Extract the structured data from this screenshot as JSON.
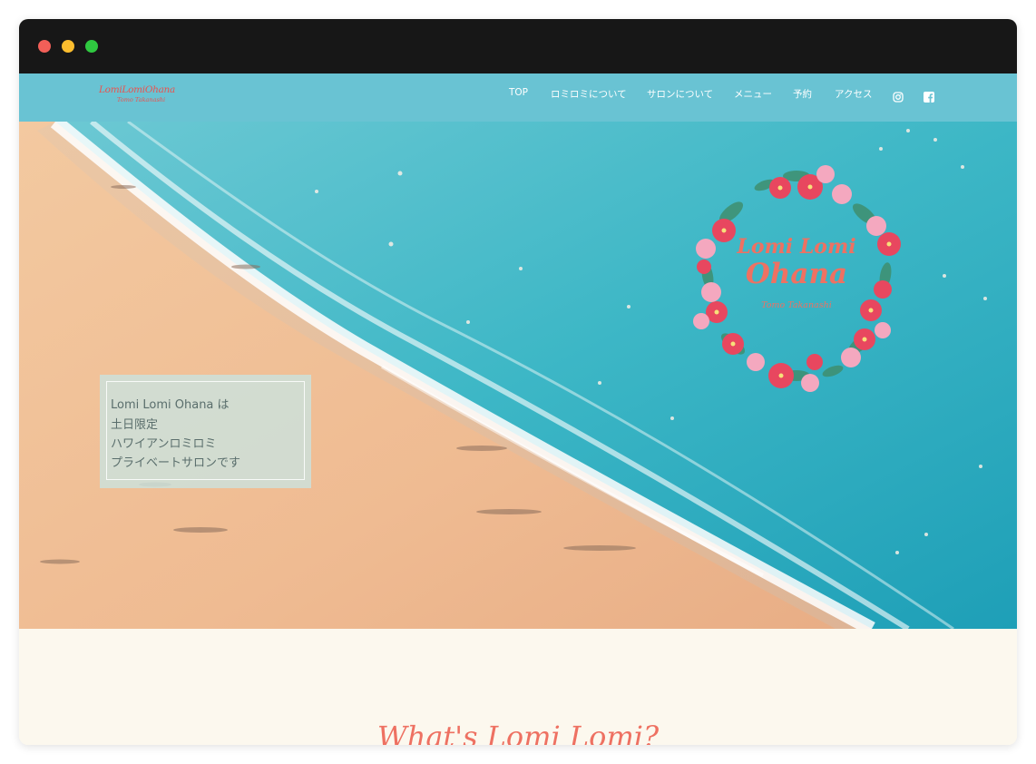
{
  "window": {
    "controls": [
      "close",
      "minimize",
      "maximize"
    ]
  },
  "header": {
    "logo": {
      "main": "LomiLomiOhana",
      "sub": "Tomo Takanashi"
    },
    "nav": [
      {
        "label": "TOP"
      },
      {
        "label": "ロミロミについて"
      },
      {
        "label": "サロンについて"
      },
      {
        "label": "メニュー"
      },
      {
        "label": "予約"
      },
      {
        "label": "アクセス"
      }
    ],
    "social": [
      {
        "icon": "instagram-icon"
      },
      {
        "icon": "facebook-icon"
      }
    ]
  },
  "hero": {
    "caption_lines": [
      "Lomi Lomi Ohana は",
      "土日限定",
      "ハワイアンロミロミ",
      "プライベートサロンです"
    ],
    "wreath": {
      "line1": "Lomi Lomi",
      "line2": "Ohana",
      "line3": "Tomo Takanashi"
    }
  },
  "section": {
    "title": "What's Lomi Lomi?"
  },
  "colors": {
    "nav_bg": "#69c3d3",
    "accent": "#ee7162",
    "page_bg": "#fcf8ee",
    "titlebar": "#171717"
  }
}
